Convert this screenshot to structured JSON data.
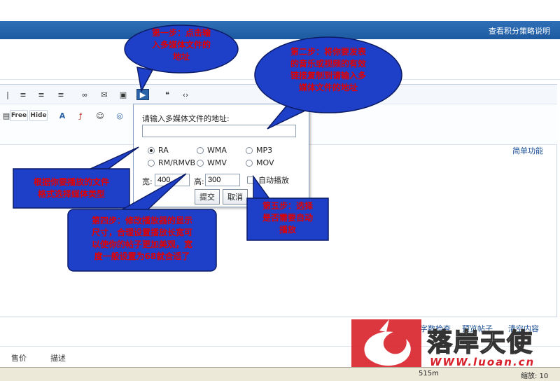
{
  "header": {
    "right_link": "查看积分策略说明"
  },
  "editor": {
    "simple_func": "简单功能"
  },
  "toolbar2": {
    "free_label": "Free",
    "hide_label": "Hide"
  },
  "dialog": {
    "url_label": "请输入多媒体文件的地址:",
    "url_value": "",
    "formats": [
      "RA",
      "WMA",
      "MP3",
      "RM/RMVB",
      "WMV",
      "MOV"
    ],
    "selected_format": "RA",
    "width_label": "宽:",
    "width_value": "400",
    "height_label": "高:",
    "height_value": "300",
    "autoplay_label": "自动播放",
    "submit_label": "提交",
    "cancel_label": "取消"
  },
  "callouts": {
    "step1": [
      "第一步：点击输",
      "入多媒体文件的",
      "地址"
    ],
    "step2": [
      "第二步：将你要发表",
      "的音乐或视频的有效",
      "链接复制到请输入多",
      "媒体文件的地址"
    ],
    "step3": [
      "根据你要播放的文件",
      "格式选择媒体类型"
    ],
    "step4": [
      "第四步：修改播放器的显示",
      "尺寸，合理设置播放长宽可",
      "以使你的帖子更加美观，宽",
      "度一般设置为68就合适了"
    ],
    "step5": [
      "第五步：选择",
      "是否需要自动",
      "播放"
    ]
  },
  "footer": {
    "links": [
      "字数检查",
      "预览帖子",
      "清空内容"
    ]
  },
  "bottom_tabs": [
    "售价",
    "描述"
  ],
  "statusbar": {
    "left": "515m",
    "right": "缩放: 10"
  },
  "watermark": {
    "brand": "落岸天使",
    "url": "WWW.luoan.cn"
  },
  "colors": {
    "callout_text": "#e00000",
    "callout_fill": "#1e3fc8",
    "header_blue": "#1d5aa0"
  }
}
